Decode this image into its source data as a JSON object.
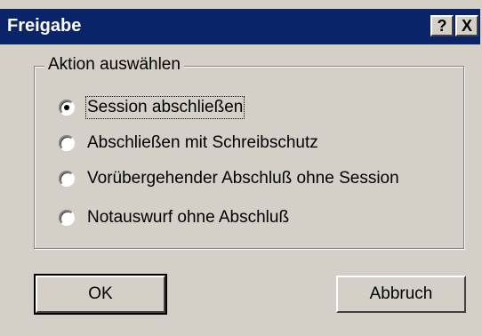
{
  "window": {
    "title": "Freigabe",
    "help_label": "?",
    "close_label": "X"
  },
  "group": {
    "label": "Aktion auswählen",
    "options": [
      {
        "label": "Session abschließen",
        "selected": true
      },
      {
        "label": "Abschließen mit Schreibschutz",
        "selected": false
      },
      {
        "label": "Vorübergehender Abschluß ohne Session",
        "selected": false
      },
      {
        "label": "Notauswurf ohne Abschluß",
        "selected": false
      }
    ]
  },
  "buttons": {
    "ok": "OK",
    "cancel": "Abbruch"
  }
}
